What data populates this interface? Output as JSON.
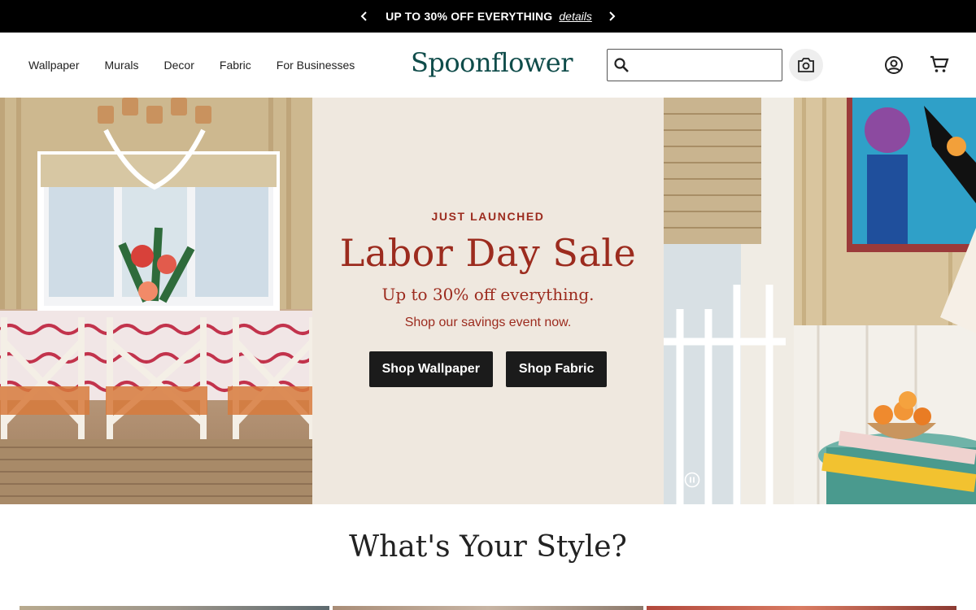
{
  "promo": {
    "text": "UP TO 30% OFF EVERYTHING",
    "link": "details"
  },
  "nav": {
    "items": [
      "Wallpaper",
      "Murals",
      "Decor",
      "Fabric",
      "For Businesses"
    ]
  },
  "logo": "Spoonflower",
  "search": {
    "value": "",
    "placeholder": ""
  },
  "hero": {
    "eyebrow": "JUST LAUNCHED",
    "headline": "Labor Day Sale",
    "subheadline": "Up to 30% off everything.",
    "body": "Shop our savings event now.",
    "buttons": [
      "Shop Wallpaper",
      "Shop Fabric"
    ]
  },
  "section": {
    "title": "What's Your Style?"
  },
  "colors": {
    "accent": "#9c2b1e",
    "brand": "#0f4c4a",
    "cta_bg": "#1b1b1b",
    "hero_bg": "#efe8df"
  }
}
